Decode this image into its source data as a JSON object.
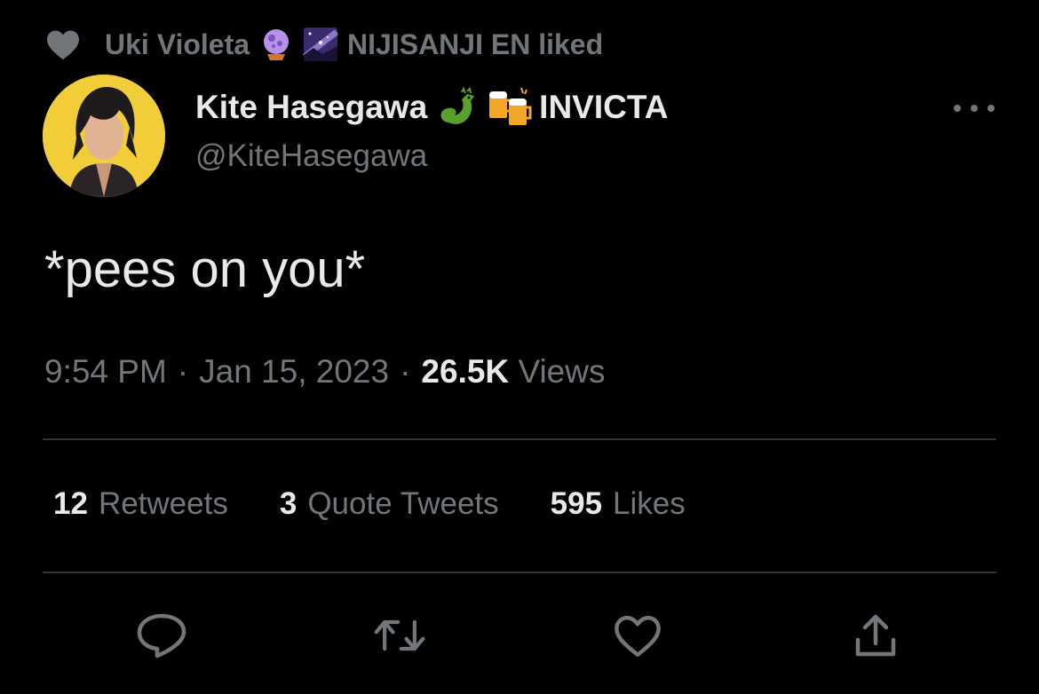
{
  "social_context": {
    "liker_name": "Uki Violeta",
    "emojis": [
      "crystal-ball-emoji",
      "milky-way-emoji"
    ],
    "suffix": "NIJISANJI EN liked"
  },
  "author": {
    "display_name": "Kite Hasegawa",
    "emojis": [
      "dragon-emoji",
      "beer-mugs-emoji"
    ],
    "name_suffix": "INVICTA",
    "handle": "@KiteHasegawa"
  },
  "tweet": {
    "text": "*pees on you*"
  },
  "meta": {
    "time": "9:54 PM",
    "sep1": "·",
    "date": "Jan 15, 2023",
    "sep2": "·",
    "views_count": "26.5K",
    "views_label": "Views"
  },
  "stats": {
    "retweets_count": "12",
    "retweets_label": "Retweets",
    "quotes_count": "3",
    "quotes_label": "Quote Tweets",
    "likes_count": "595",
    "likes_label": "Likes"
  },
  "actions": [
    "reply-icon",
    "retweet-icon",
    "like-icon",
    "share-icon"
  ],
  "colors": {
    "background": "#000000",
    "primary_text": "#e7e9ea",
    "secondary_text": "#71767b",
    "divider": "#2f3336",
    "avatar_bg": "#f1cd3a"
  }
}
